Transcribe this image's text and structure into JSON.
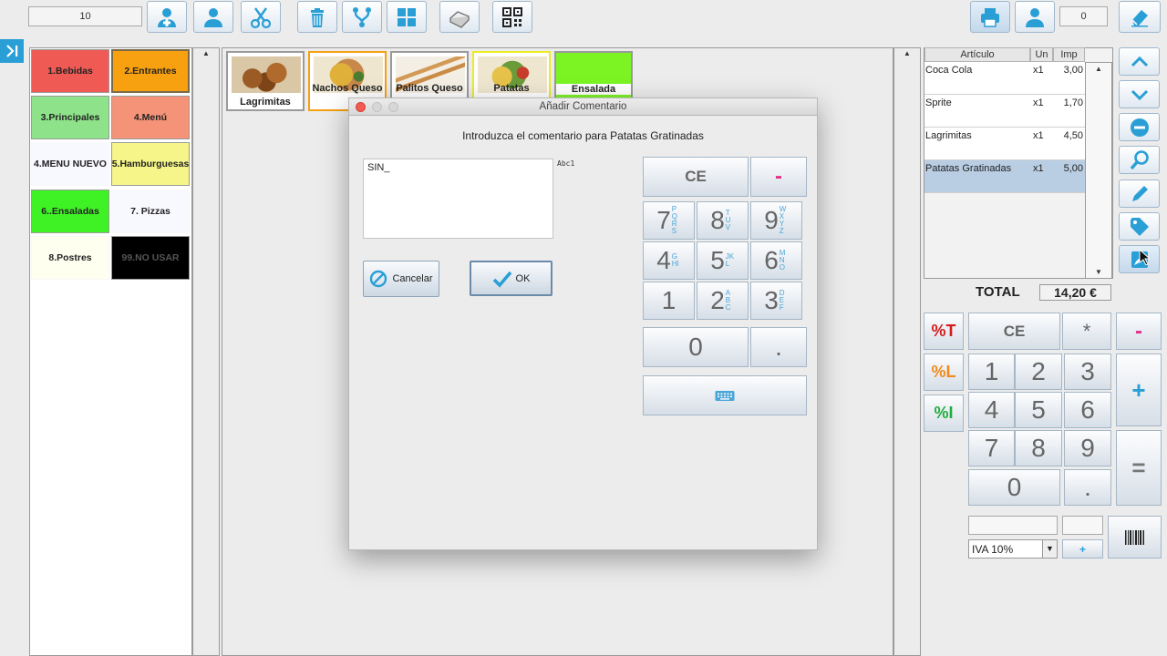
{
  "topbar": {
    "table_number": "10",
    "right_counter": "0"
  },
  "categories": [
    {
      "label": "1.Bebidas",
      "bg": "#ef5a55",
      "fg": "#222222"
    },
    {
      "label": "2.Entrantes",
      "bg": "#f7a010",
      "fg": "#222222"
    },
    {
      "label": "3.Principales",
      "bg": "#8ee28a",
      "fg": "#222222"
    },
    {
      "label": "4.Menú",
      "bg": "#f49377",
      "fg": "#222222"
    },
    {
      "label": "4.MENU NUEVO",
      "bg": "#f8f8ff",
      "fg": "#222222"
    },
    {
      "label": "5.Hamburguesas",
      "bg": "#f5f58a",
      "fg": "#222222"
    },
    {
      "label": "6..Ensaladas",
      "bg": "#3ff225",
      "fg": "#222222"
    },
    {
      "label": "7. Pizzas",
      "bg": "#f8f8ff",
      "fg": "#222222"
    },
    {
      "label": "8.Postres",
      "bg": "#fffff0",
      "fg": "#222222"
    },
    {
      "label": "99.NO USAR",
      "bg": "#000000",
      "fg": "#555555"
    }
  ],
  "products": [
    {
      "label": "Lagrimitas",
      "border": "#9a9a9a",
      "bg": "#ffffff"
    },
    {
      "label": "Nachos Queso",
      "border": "#f7a010",
      "bg": "#ffffff"
    },
    {
      "label": "Palitos Queso",
      "border": "#9a9a9a",
      "bg": "#ffffff"
    },
    {
      "label": "Patatas",
      "border": "#ecec24",
      "bg": "#ffffff"
    },
    {
      "label": "Ensalada",
      "border": "#9a9a9a",
      "bg": "#7cf423"
    }
  ],
  "ticket": {
    "headers": [
      "Artículo",
      "Un",
      "Imp"
    ],
    "rows": [
      {
        "name": "Coca Cola",
        "qty": "x1",
        "price": "3,00"
      },
      {
        "name": "Sprite",
        "qty": "x1",
        "price": "1,70"
      },
      {
        "name": "Lagrimitas",
        "qty": "x1",
        "price": "4,50"
      },
      {
        "name": "Patatas Gratinadas",
        "qty": "x1",
        "price": "5,00"
      }
    ],
    "total_label": "TOTAL",
    "total_value": "14,20 €"
  },
  "calculator": {
    "ce": "CE",
    "times": "*",
    "minus": "-",
    "plus": "+",
    "equals": "=",
    "pct_t": "%T",
    "pct_l": "%L",
    "pct_i": "%I",
    "digits": [
      "1",
      "2",
      "3",
      "4",
      "5",
      "6",
      "7",
      "8",
      "9"
    ],
    "zero": "0",
    "dot": ".",
    "tax_select": "IVA 10%",
    "tax_add": "+"
  },
  "dialog": {
    "title": "Añadir Comentario",
    "prompt": "Introduzca el comentario para Patatas Gratinadas",
    "comment_value": "SIN_",
    "input_mode": "Abc1",
    "cancel_label": "Cancelar",
    "ok_label": "OK",
    "keypad": {
      "ce": "CE",
      "minus": "-",
      "zero": "0",
      "dot": ".",
      "keys": [
        {
          "d": "7",
          "s": "PQRS"
        },
        {
          "d": "8",
          "s": "TUV"
        },
        {
          "d": "9",
          "s": "WXYZ"
        },
        {
          "d": "4",
          "s": "GHI"
        },
        {
          "d": "5",
          "s": "JKL"
        },
        {
          "d": "6",
          "s": "MNO"
        },
        {
          "d": "1",
          "s": ""
        },
        {
          "d": "2",
          "s": "ABC"
        },
        {
          "d": "3",
          "s": "DEF"
        }
      ]
    }
  },
  "colors": {
    "accent": "#2a9fd6",
    "magenta": "#e0308a",
    "pct_t": "#d41c1c",
    "pct_l": "#f08a1e",
    "pct_i": "#1fae3f"
  }
}
